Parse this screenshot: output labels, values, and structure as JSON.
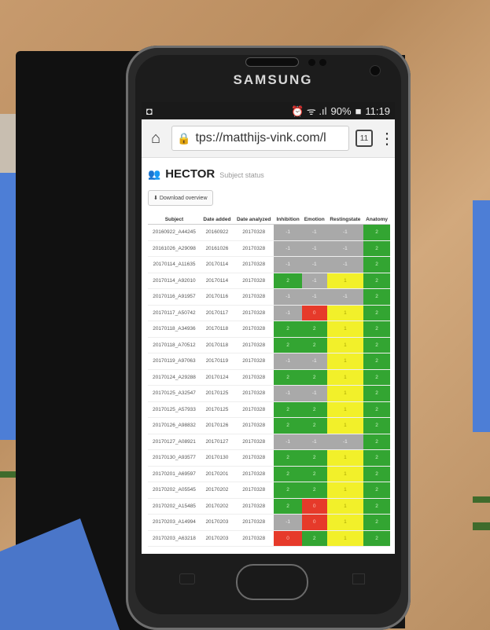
{
  "phone": {
    "brand": "SAMSUNG"
  },
  "status_bar": {
    "icons": "⏰ ᯤ .ıl",
    "battery": "90%",
    "battery_glyph": "■",
    "time": "11:19"
  },
  "browser": {
    "url": "tps://matthijs-vink.com/l",
    "tab_count": "11",
    "home_icon": "home-icon",
    "menu_icon": "kebab-menu-icon"
  },
  "page": {
    "title": "HECTOR",
    "subtitle": "Subject status",
    "download_label": "Download overview"
  },
  "table": {
    "headers": [
      "Subject",
      "Date added",
      "Date analyzed",
      "Inhibition",
      "Emotion",
      "Restingstate",
      "Anatomy"
    ],
    "rows": [
      [
        "20160922_A44245",
        "20160922",
        "20170328",
        "-1",
        "-1",
        "-1",
        "2"
      ],
      [
        "20161026_A29098",
        "20161026",
        "20170328",
        "-1",
        "-1",
        "-1",
        "2"
      ],
      [
        "20170114_A11635",
        "20170114",
        "20170328",
        "-1",
        "-1",
        "-1",
        "2"
      ],
      [
        "20170114_A92010",
        "20170114",
        "20170328",
        "2",
        "-1",
        "1",
        "2"
      ],
      [
        "20170116_A91957",
        "20170116",
        "20170328",
        "-1",
        "-1",
        "-1",
        "2"
      ],
      [
        "20170117_A50742",
        "20170117",
        "20170328",
        "-1",
        "0",
        "1",
        "2"
      ],
      [
        "20170118_A34936",
        "20170118",
        "20170328",
        "2",
        "2",
        "1",
        "2"
      ],
      [
        "20170118_A70512",
        "20170118",
        "20170328",
        "2",
        "2",
        "1",
        "2"
      ],
      [
        "20170119_A97063",
        "20170119",
        "20170328",
        "-1",
        "-1",
        "1",
        "2"
      ],
      [
        "20170124_A29288",
        "20170124",
        "20170328",
        "2",
        "2",
        "1",
        "2"
      ],
      [
        "20170125_A32547",
        "20170125",
        "20170328",
        "-1",
        "-1",
        "1",
        "2"
      ],
      [
        "20170125_A57933",
        "20170125",
        "20170328",
        "2",
        "2",
        "1",
        "2"
      ],
      [
        "20170126_A98832",
        "20170126",
        "20170328",
        "2",
        "2",
        "1",
        "2"
      ],
      [
        "20170127_A08921",
        "20170127",
        "20170328",
        "-1",
        "-1",
        "-1",
        "2"
      ],
      [
        "20170130_A93577",
        "20170130",
        "20170328",
        "2",
        "2",
        "1",
        "2"
      ],
      [
        "20170201_A69597",
        "20170201",
        "20170328",
        "2",
        "2",
        "1",
        "2"
      ],
      [
        "20170202_A05545",
        "20170202",
        "20170328",
        "2",
        "2",
        "1",
        "2"
      ],
      [
        "20170202_A15485",
        "20170202",
        "20170328",
        "2",
        "0",
        "1",
        "2"
      ],
      [
        "20170203_A14994",
        "20170203",
        "20170328",
        "-1",
        "0",
        "1",
        "2"
      ],
      [
        "20170203_A63218",
        "20170203",
        "20170328",
        "0",
        "2",
        "1",
        "2"
      ]
    ]
  },
  "colors": {
    "green": "#33a532",
    "yellow": "#f2f02a",
    "red": "#e63a2a",
    "grey": "#a9a9a9",
    "accent_blue": "#4d7ed6"
  }
}
